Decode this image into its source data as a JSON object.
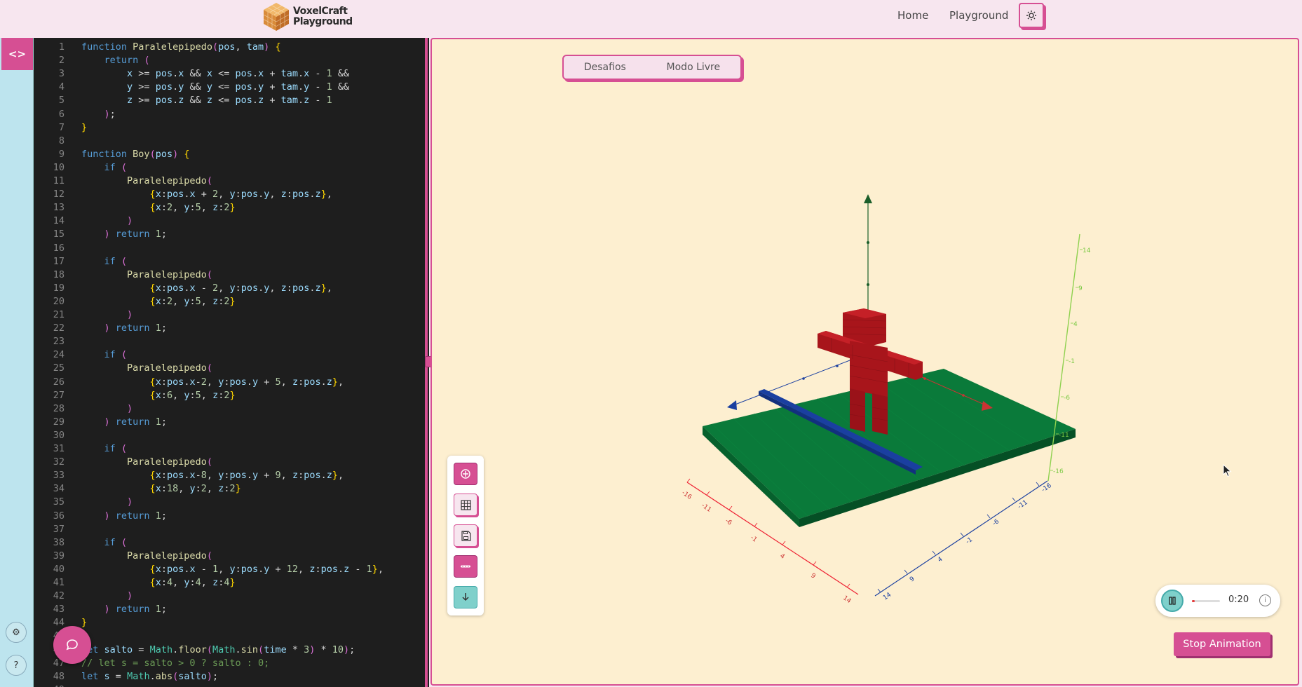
{
  "app": {
    "logo_line1": "VoxelCraft",
    "logo_line2": "Playground"
  },
  "nav": {
    "home": "Home",
    "playground": "Playground",
    "theme_icon": "sun-icon"
  },
  "rail": {
    "code_icon": "code-icon",
    "code_glyph": "<>",
    "settings_icon": "gear-icon",
    "help_icon": "help-icon"
  },
  "editor": {
    "lines": [
      "function Paralelepipedo(pos, tam) {",
      "    return (",
      "        x >= pos.x && x <= pos.x + tam.x - 1 &&",
      "        y >= pos.y && y <= pos.y + tam.y - 1 &&",
      "        z >= pos.z && z <= pos.z + tam.z - 1",
      "    );",
      "}",
      "",
      "function Boy(pos) {",
      "    if (",
      "        Paralelepipedo(",
      "            {x:pos.x + 2, y:pos.y, z:pos.z},",
      "            {x:2, y:5, z:2}",
      "        )",
      "    ) return 1;",
      "",
      "    if (",
      "        Paralelepipedo(",
      "            {x:pos.x - 2, y:pos.y, z:pos.z},",
      "            {x:2, y:5, z:2}",
      "        )",
      "    ) return 1;",
      "",
      "    if (",
      "        Paralelepipedo(",
      "            {x:pos.x-2, y:pos.y + 5, z:pos.z},",
      "            {x:6, y:5, z:2}",
      "        )",
      "    ) return 1;",
      "",
      "    if (",
      "        Paralelepipedo(",
      "            {x:pos.x-8, y:pos.y + 9, z:pos.z},",
      "            {x:18, y:2, z:2}",
      "        )",
      "    ) return 1;",
      "",
      "    if (",
      "        Paralelepipedo(",
      "            {x:pos.x - 1, y:pos.y + 12, z:pos.z - 1},",
      "            {x:4, y:4, z:4}",
      "        )",
      "    ) return 1;",
      "}",
      "",
      "let salto = Math.floor(Math.sin(time * 3) * 10);",
      "// let s = salto > 0 ? salto : 0;",
      "let s = Math.abs(salto);",
      ""
    ]
  },
  "canvas": {
    "tabs": [
      "Desafios",
      "Modo Livre"
    ],
    "axis_ticks_red": [
      "-16",
      "-11",
      "-6",
      "-1",
      "4",
      "9",
      "14"
    ],
    "axis_ticks_blue": [
      "14",
      "9",
      "4",
      "-1",
      "-6",
      "-11",
      "-16"
    ],
    "axis_ticks_green": [
      "14",
      "9",
      "4",
      "-1",
      "-6",
      "-11",
      "-16"
    ],
    "colors": {
      "ground": "#0a7a3a",
      "boy": "#a8151b",
      "rod": "#1a3fa0",
      "bg": "#fdefd0",
      "accent": "#d64f93"
    }
  },
  "toolbar": {
    "tools": [
      "crosshair-icon",
      "grid-icon",
      "save-icon",
      "more-icon",
      "download-icon"
    ]
  },
  "player": {
    "play_icon": "pause-icon",
    "progress": 0.1,
    "time": "0:20",
    "info_icon": "info-icon"
  },
  "actions": {
    "stop_animation": "Stop Animation",
    "chat_icon": "chat-icon"
  }
}
